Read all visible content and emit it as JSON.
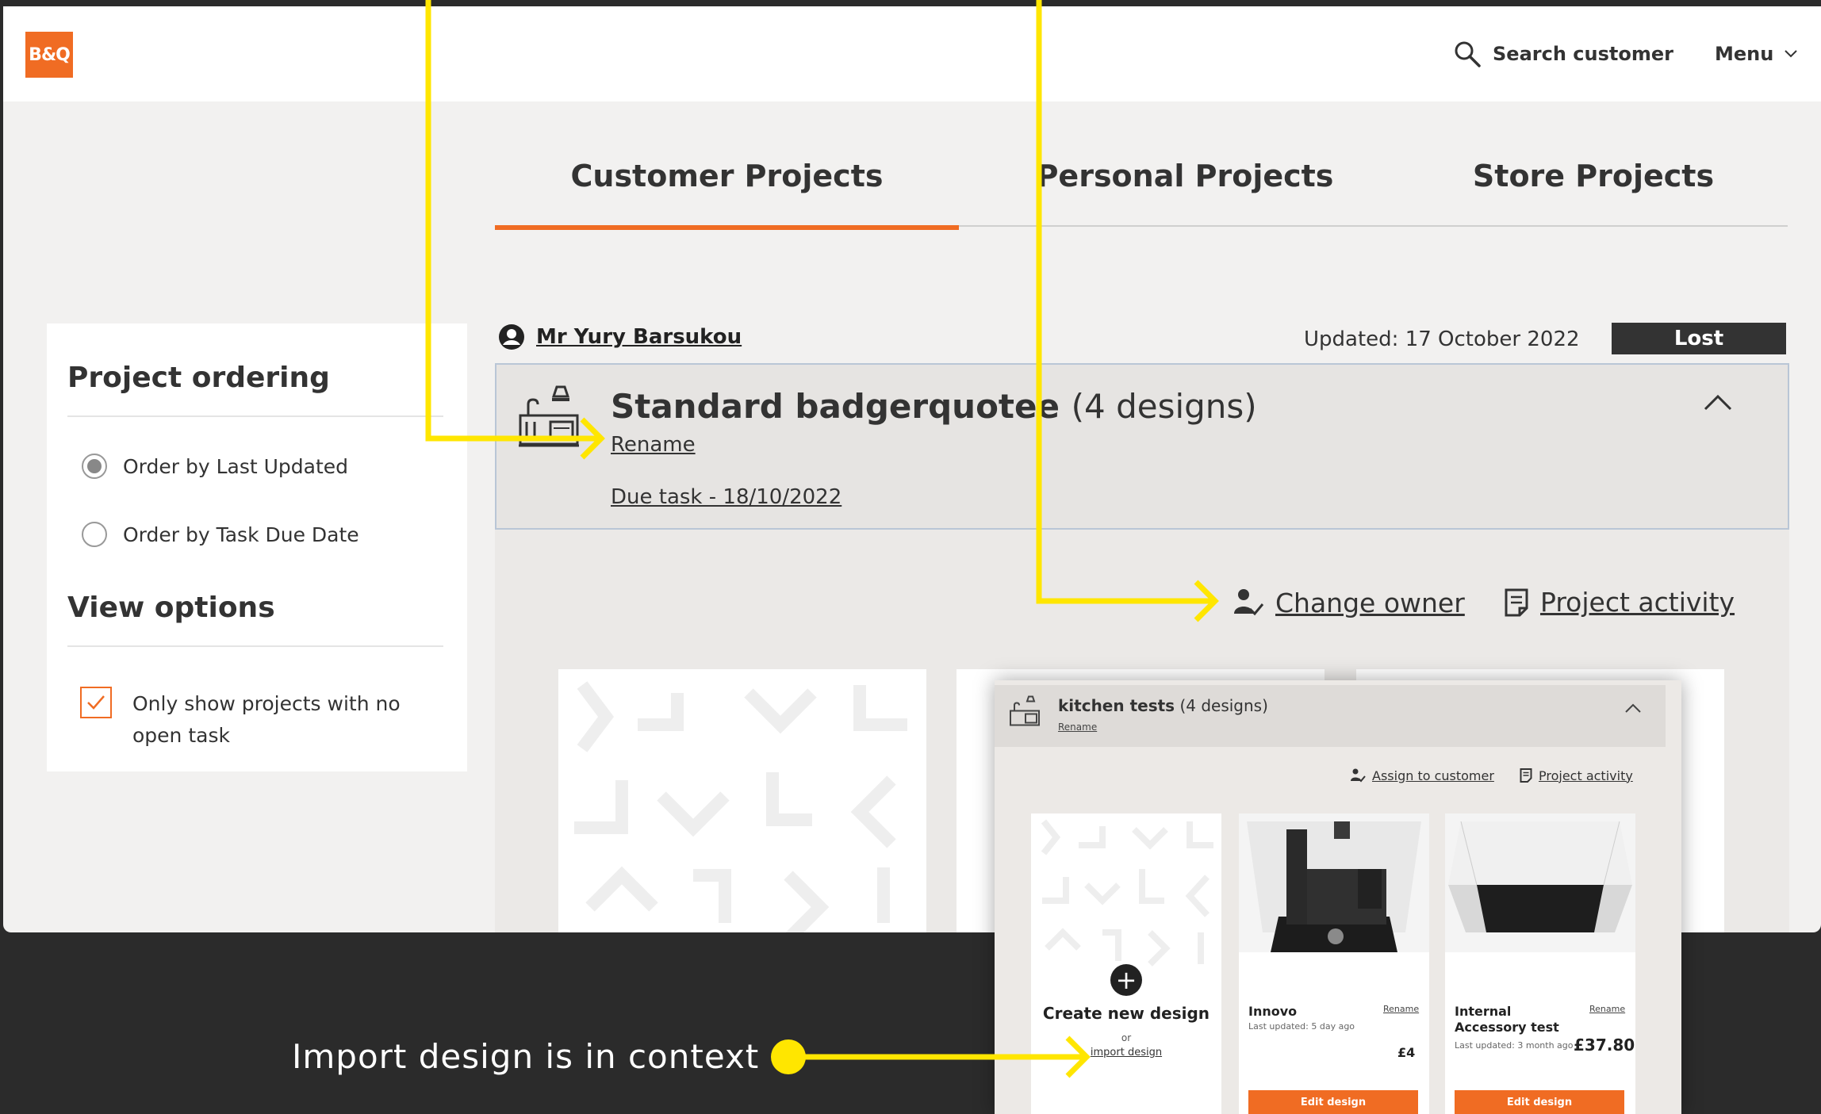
{
  "header": {
    "logo_text": "B&Q",
    "search_label": "Search customer",
    "menu_label": "Menu"
  },
  "tabs": [
    {
      "label": "Customer Projects",
      "active": true
    },
    {
      "label": "Personal Projects",
      "active": false
    },
    {
      "label": "Store Projects",
      "active": false
    }
  ],
  "sidebar": {
    "ordering_title": "Project ordering",
    "order_options": [
      {
        "label": "Order by Last Updated",
        "selected": true
      },
      {
        "label": "Order by Task Due Date",
        "selected": false
      }
    ],
    "view_title": "View options",
    "view_option_line1": "Only show projects with no",
    "view_option_line2": "open task",
    "view_option_checked": true
  },
  "project": {
    "customer_name": "Mr Yury Barsukou",
    "updated_text": "Updated: 17 October 2022",
    "status": "Lost",
    "title": "Standard badgerquotee",
    "design_count": "(4 designs)",
    "rename_label": "Rename",
    "due_task": "Due task - 18/10/2022",
    "change_owner_label": "Change owner",
    "project_activity_label": "Project activity"
  },
  "popup": {
    "title": "kitchen tests",
    "design_count": "(4 designs)",
    "rename_label": "Rename",
    "assign_label": "Assign to customer",
    "activity_label": "Project activity",
    "create_label": "Create new design",
    "or_label": "or",
    "import_label": "import design",
    "cards": [
      {
        "name": "Innovo",
        "name2": "",
        "updated": "Last updated: 5 day ago",
        "price": "£4",
        "rename": "Rename",
        "edit": "Edit design"
      },
      {
        "name": "Internal",
        "name2": "Accessory test",
        "updated": "Last updated: 3 month ago",
        "price": "£37.80",
        "rename": "Rename",
        "edit": "Edit design"
      }
    ]
  },
  "annotation": {
    "text": "Import design is in context"
  },
  "colors": {
    "accent": "#f06c23",
    "highlight": "#ffe600",
    "dark": "#2b2b2b"
  }
}
